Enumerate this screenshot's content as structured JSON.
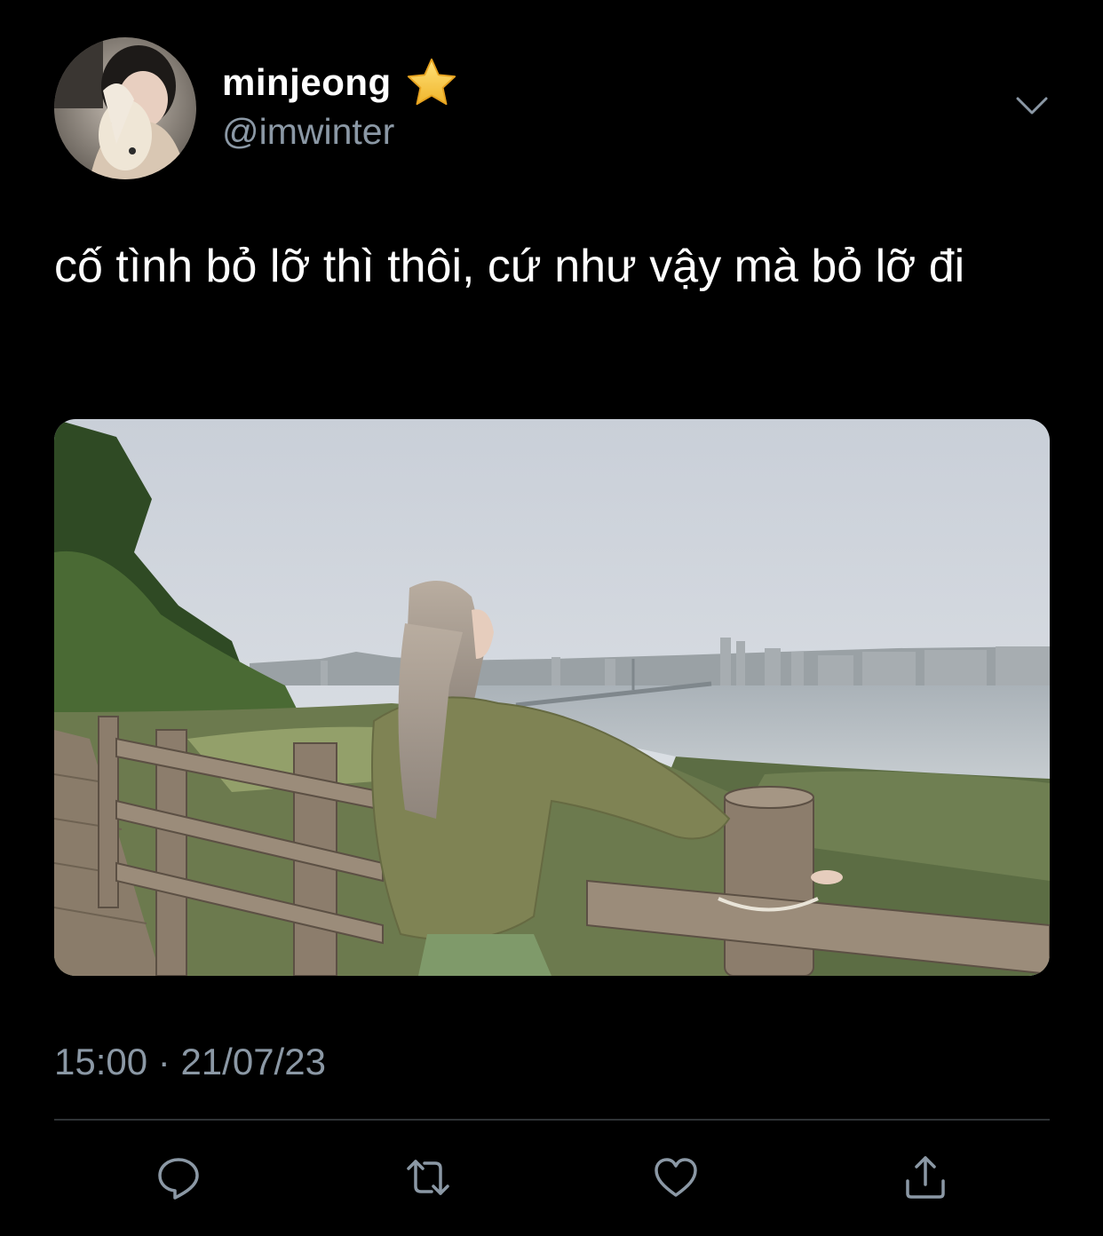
{
  "user": {
    "display_name": "minjeong",
    "handle": "@imwinter",
    "badge_icon": "star-icon"
  },
  "tweet": {
    "text": "cố tình bỏ lỡ thì thôi, cứ như vậy mà bỏ lỡ đi",
    "time": "15:00",
    "separator": "·",
    "date": "21/07/23"
  },
  "actions": [
    {
      "name": "reply",
      "icon": "reply-icon"
    },
    {
      "name": "retweet",
      "icon": "retweet-icon"
    },
    {
      "name": "like",
      "icon": "heart-icon"
    },
    {
      "name": "share",
      "icon": "share-icon"
    }
  ],
  "colors": {
    "background": "#000000",
    "secondary_text": "#8b98a5",
    "divider": "#2f3336",
    "star": "#f5c842"
  }
}
